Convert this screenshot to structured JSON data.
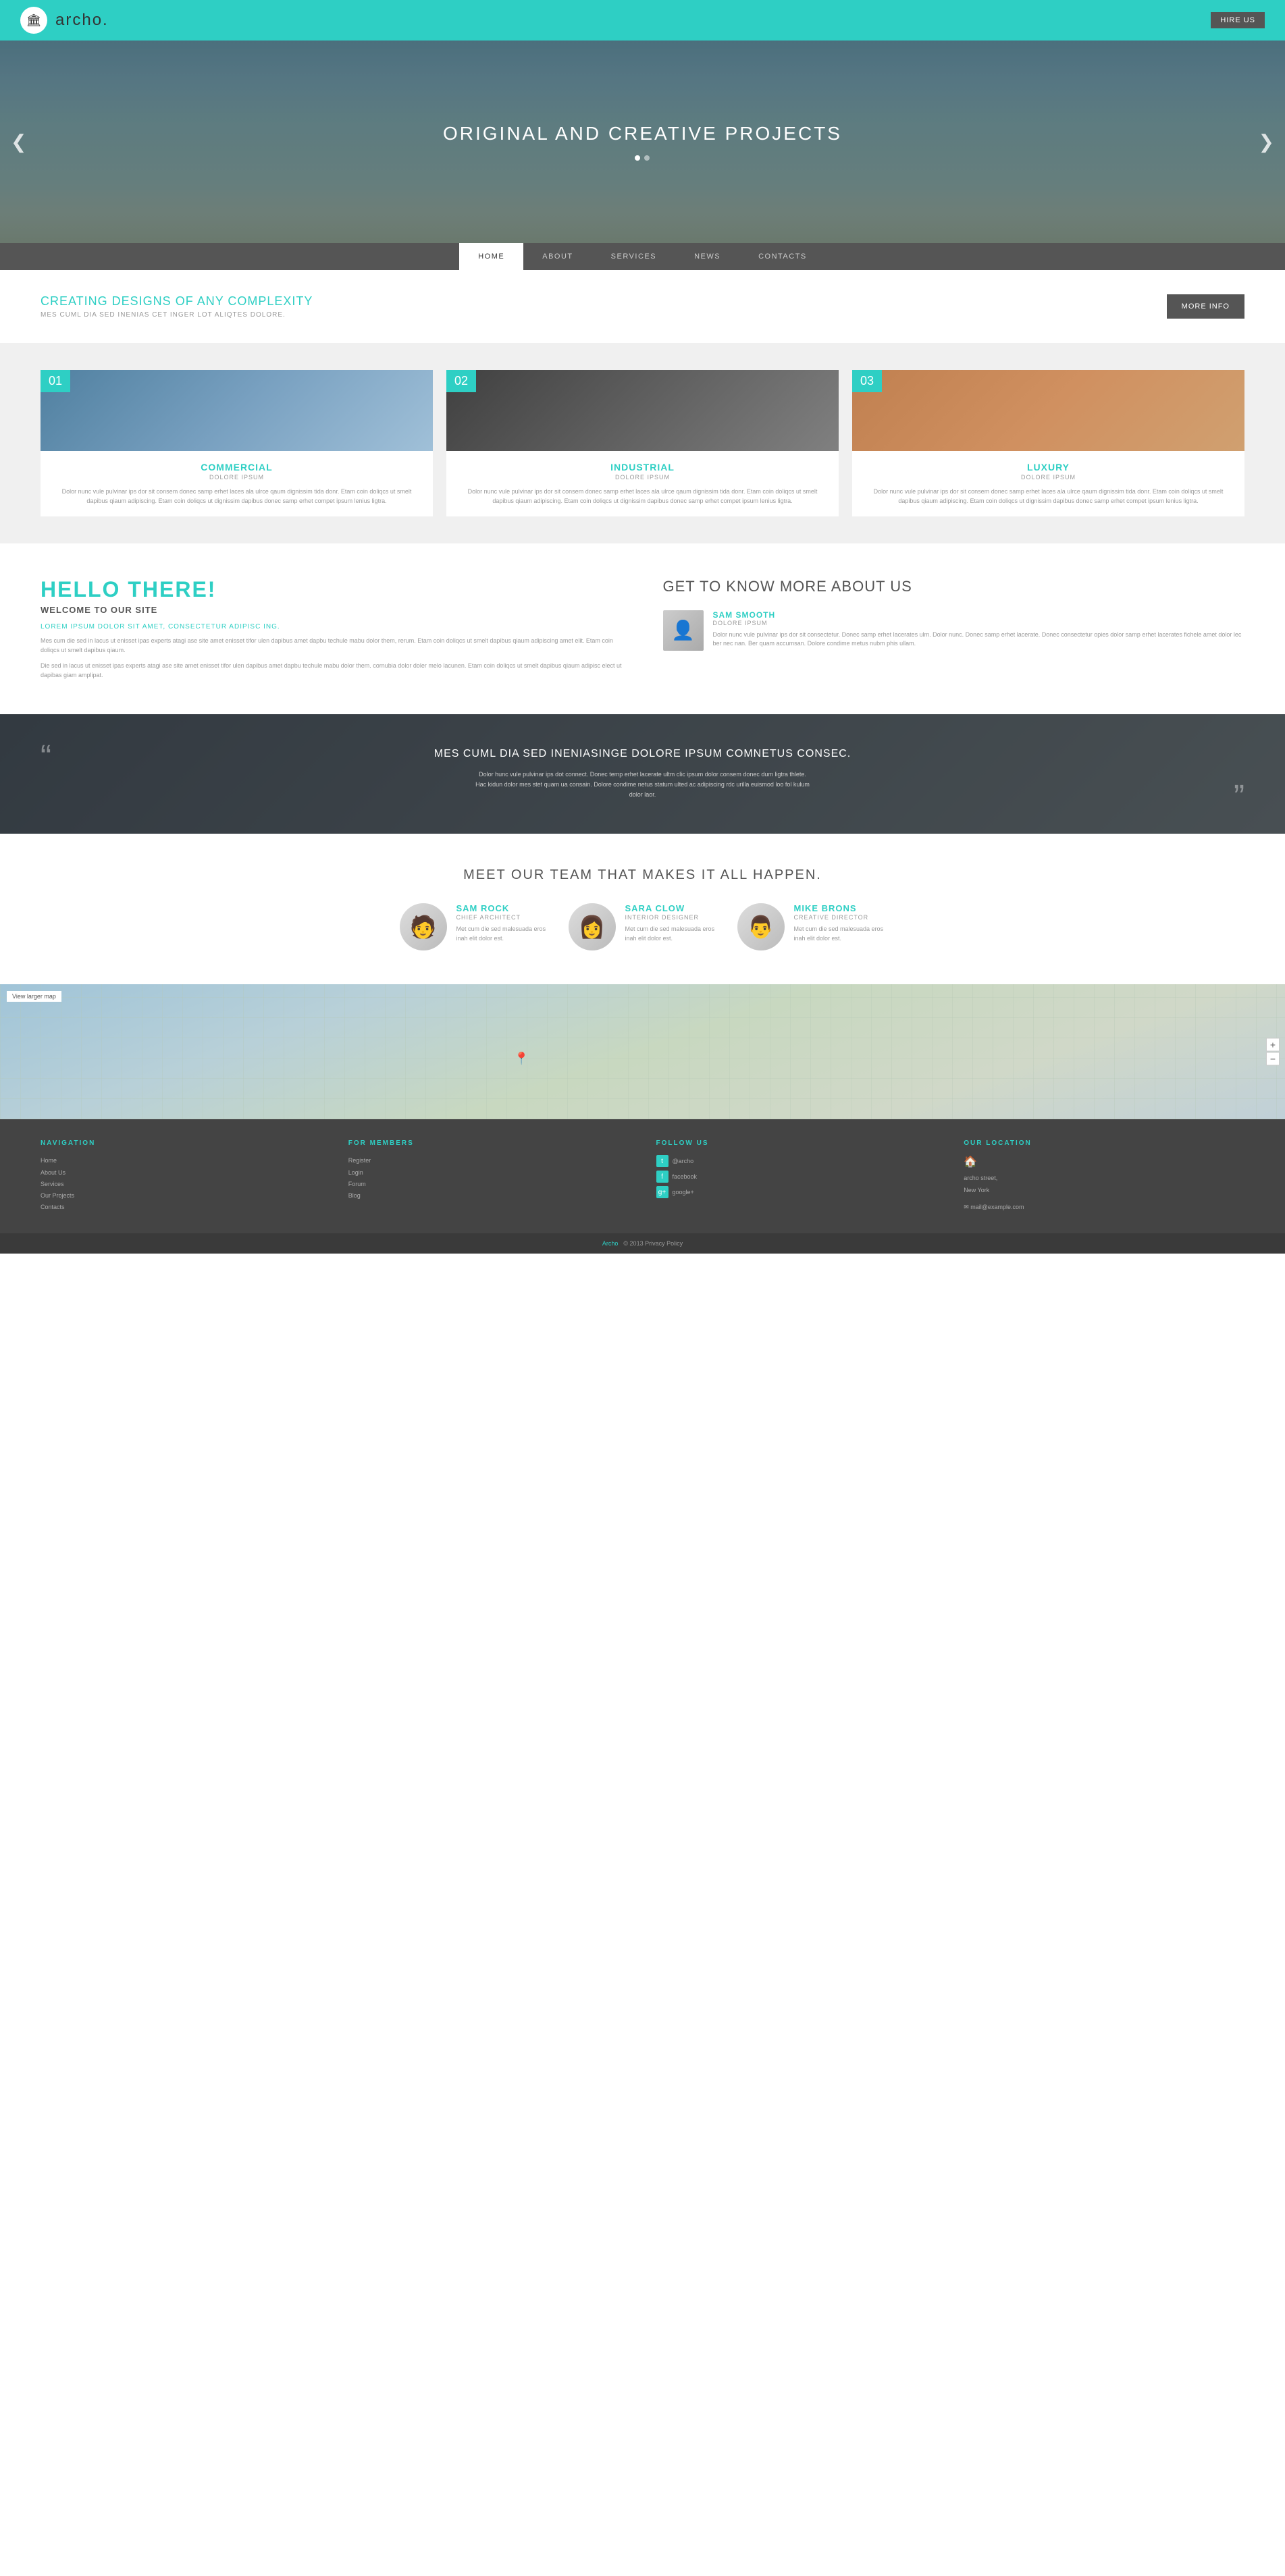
{
  "header": {
    "logo_text": "archo.",
    "hire_btn": "HIRE US"
  },
  "hero": {
    "title": "ORIGINAL AND CREATIVE PROJECTS",
    "dots": [
      true,
      false
    ],
    "arrow_left": "❮",
    "arrow_right": "❯"
  },
  "nav": {
    "items": [
      {
        "label": "HOME",
        "active": true
      },
      {
        "label": "ABOUT",
        "active": false
      },
      {
        "label": "SERVICES",
        "active": false
      },
      {
        "label": "NEWS",
        "active": false
      },
      {
        "label": "CONTACTS",
        "active": false
      }
    ]
  },
  "intro": {
    "title": "CREATING DESIGNS OF ANY COMPLEXITY",
    "subtitle": "MES CUML DIA SED INENIAS CET INGER LOT ALIQTES DOLORE.",
    "more_info_btn": "MORE INFO"
  },
  "cards": {
    "items": [
      {
        "num": "01",
        "title": "COMMERCIAL",
        "subtitle": "DOLORE IPSUM",
        "text": "Dolor nunc vule pulvinar ips dor sit consem donec samp erhet laces ala ulrce qaum dignissim tida donr. Etam coin doliqcs ut smelt dapibus qiaum adipiscing. Etam coin doliqcs ut dignissim dapibus donec samp erhet compet ipsum lenius ligtra."
      },
      {
        "num": "02",
        "title": "INDUSTRIAL",
        "subtitle": "DOLORE IPSUM",
        "text": "Dolor nunc vule pulvinar ips dor sit consem donec samp erhet laces ala ulrce qaum dignissim tida donr. Etam coin doliqcs ut smelt dapibus qiaum adipiscing. Etam coin doliqcs ut dignissim dapibus donec samp erhet compet ipsum lenius ligtra."
      },
      {
        "num": "03",
        "title": "LUXURY",
        "subtitle": "DOLORE IPSUM",
        "text": "Dolor nunc vule pulvinar ips dor sit consem donec samp erhet laces ala ulrce qaum dignissim tida donr. Etam coin doliqcs ut smelt dapibus qiaum adipiscing. Etam coin doliqcs ut dignissim dapibus donec samp erhet compet ipsum lenius ligtra."
      }
    ]
  },
  "about": {
    "hello": "HELLO THERE!",
    "welcome": "WELCOME TO OUR SITE",
    "lorem_title": "LOREM IPSUM DOLOR SIT AMET, CONSECTETUR ADIPISC ING.",
    "para1": "Mes cum die sed in lacus ut enisset ipas experts atagi ase site amet enisset tifor ulen dapibus amet dapbu techule mabu dolor them, rerum. Etam coin doliqcs ut smelt dapibus qiaum adipiscing amet elit. Etam coin doliqcs ut smelt dapibus qiaum.",
    "para2": "Die sed in lacus ut enisset ipas experts atagi ase site amet enisset tifor ulen dapibus amet dapbu techule mabu dolor them. cornubia dolor doler melo lacunen. Etam coin doliqcs ut smelt dapibus qiaum adipisc elect ut dapibas giam amplipat.",
    "right_title": "GET TO KNOW MORE ABOUT US",
    "person": {
      "name": "SAM SMOOTH",
      "role": "DOLORE IPSUM",
      "desc": "Dolor nunc vule pulvinar ips dor sit consectetur. Donec samp erhet lacerates ulm. Dolor nunc. Donec samp erhet lacerate. Donec consectetur opies dolor samp erhet lacerates fichele amet dolor lec ber nec nan. Ber quam accumsan. Dolore condime metus nubm phis ullam."
    }
  },
  "quote": {
    "quote_left": "“",
    "quote_right": "”",
    "main": "MES CUML DIA SED INENIASINGE DOLORE IPSUM COMNETUS CONSEC.",
    "text": "Dolor hunc vule pulvinar ips dot connect. Donec temp erhet lacerate ultm clic ipsum dolor consem donec dum ligtra thlete. Hac kidun dolor mes stet quam ua consain. Dolore condime netus statum ulted ac adipiscing rdc urilla euismod loo fol kulum dolor laor."
  },
  "team": {
    "title": "MEET OUR TEAM THAT MAKES IT ALL HAPPEN.",
    "members": [
      {
        "name": "SAM ROCK",
        "role": "CHIEF ARCHITECT",
        "text": "Met cum die sed malesuada eros inah elit dolor est."
      },
      {
        "name": "SARA CLOW",
        "role": "INTERIOR DESIGNER",
        "text": "Met cum die sed malesuada eros inah elit dolor est."
      },
      {
        "name": "MIKE BRONS",
        "role": "CREATIVE DIRECTOR",
        "text": "Met cum die sed malesuada eros inah elit dolor est."
      }
    ]
  },
  "map": {
    "view_larger": "View larger map"
  },
  "footer": {
    "nav_title": "NAVIGATION",
    "nav_links": [
      "Home",
      "About Us",
      "Services",
      "Our Projects",
      "Contacts"
    ],
    "members_title": "FOR MEMBERS",
    "members_links": [
      "Register",
      "Login",
      "Forum",
      "Blog"
    ],
    "follow_title": "FOLLOW US",
    "follow_items": [
      {
        "icon": "t",
        "label": "@archo"
      },
      {
        "icon": "f",
        "label": "facebook"
      },
      {
        "icon": "g",
        "label": "google+"
      }
    ],
    "location_title": "OUR LOCATION",
    "location_icon": "🏠",
    "location_lines": [
      "archo street,",
      "New York"
    ],
    "email_icon": "✉",
    "email": "mail@example.com",
    "bottom_brand": "Archo",
    "bottom_text": "© 2013 Privacy Policy"
  }
}
